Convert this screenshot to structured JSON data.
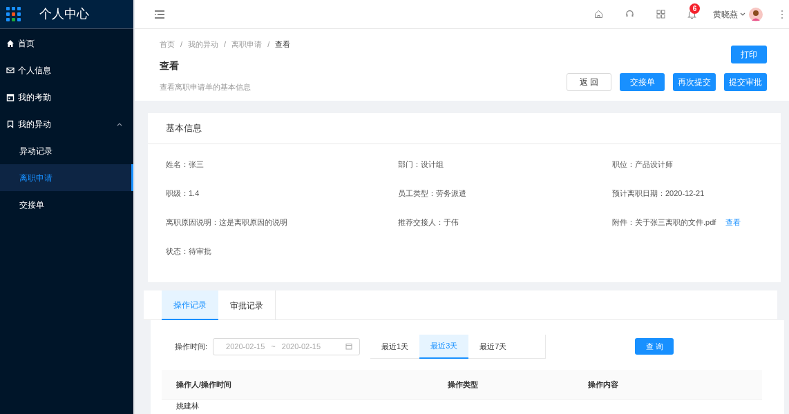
{
  "app": {
    "title": "个人中心"
  },
  "sidebar": {
    "items": [
      {
        "label": "首页",
        "selected": false
      },
      {
        "label": "个人信息",
        "selected": false
      },
      {
        "label": "我的考勤",
        "selected": false
      },
      {
        "label": "我的异动",
        "selected": false,
        "expanded": true,
        "children": [
          {
            "label": "异动记录",
            "selected": false
          },
          {
            "label": "离职申请",
            "selected": true
          },
          {
            "label": "交接单",
            "selected": false
          }
        ]
      }
    ]
  },
  "topbar": {
    "notification_count": "6",
    "user": "黄晓燕"
  },
  "page_header": {
    "breadcrumb": [
      {
        "kind": "link",
        "text": "首页"
      },
      {
        "kind": "separator",
        "text": "/"
      },
      {
        "kind": "link",
        "text": "我的异动"
      },
      {
        "kind": "separator",
        "text": "/"
      },
      {
        "kind": "link",
        "text": "离职申请"
      },
      {
        "kind": "separator",
        "text": "/"
      },
      {
        "kind": "current",
        "text": "查看"
      }
    ],
    "title": "查看",
    "description": "查看离职申请单的基本信息",
    "print_button": "打印",
    "buttons": [
      {
        "label": "返 回",
        "kind": "default"
      },
      {
        "label": "交接单",
        "kind": "primary"
      },
      {
        "label": "再次提交",
        "kind": "primary"
      },
      {
        "label": "提交审批",
        "kind": "primary"
      }
    ]
  },
  "basic_info": {
    "title": "基本信息",
    "fields": [
      {
        "label": "姓名：",
        "value": "张三"
      },
      {
        "label": "部门：",
        "value": "设计组"
      },
      {
        "label": "职位：",
        "value": "产品设计师"
      },
      {
        "label": "职级：",
        "value": "1.4"
      },
      {
        "label": "员工类型：",
        "value": "劳务派遣"
      },
      {
        "label": "预计离职日期：",
        "value": "2020-12-21"
      },
      {
        "label": "离职原因说明：",
        "value": "这是离职原因的说明"
      },
      {
        "label": "推荐交接人：",
        "value": "于伟"
      },
      {
        "label": "附件：",
        "value": "关于张三离职的文件.pdf",
        "link": "查看"
      },
      {
        "label": "状态：",
        "value": "待审批"
      }
    ]
  },
  "record_tabs": [
    {
      "label": "操作记录",
      "selected": true
    },
    {
      "label": "审批记录",
      "selected": false
    }
  ],
  "filter": {
    "label": "操作时间:",
    "start": "2020-02-15",
    "separator": "~",
    "end": "2020-02-15",
    "ranges": [
      {
        "label": "最近1天",
        "selected": false
      },
      {
        "label": "最近3天",
        "selected": true
      },
      {
        "label": "最近7天",
        "selected": false
      }
    ],
    "query_button": "查 询"
  },
  "table": {
    "columns": [
      "操作人/操作时间",
      "操作类型",
      "操作内容"
    ],
    "rows": [
      [
        "姚建林"
      ]
    ]
  }
}
